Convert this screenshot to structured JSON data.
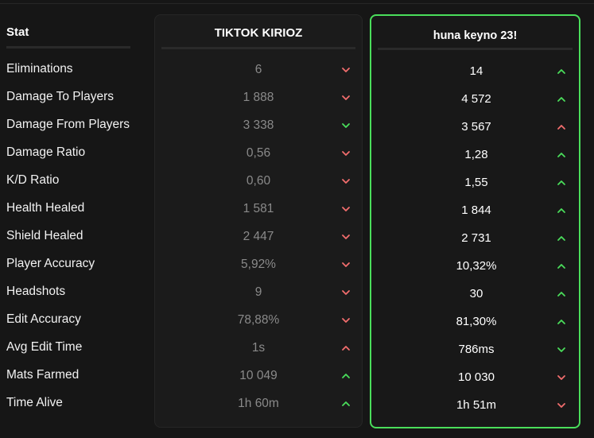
{
  "colors": {
    "up": "#4ade5b",
    "down": "#f26d6d",
    "highlight_border": "#4ade5b",
    "muted_value": "#8a8a8a"
  },
  "stat_header": "Stat",
  "players": [
    {
      "name": "TIKTOK KIRIOZ",
      "values": [
        {
          "value": "6",
          "trend": "down"
        },
        {
          "value": "1 888",
          "trend": "down"
        },
        {
          "value": "3 338",
          "trend": "down"
        },
        {
          "value": "0,56",
          "trend": "down"
        },
        {
          "value": "0,60",
          "trend": "down"
        },
        {
          "value": "1 581",
          "trend": "down"
        },
        {
          "value": "2 447",
          "trend": "down"
        },
        {
          "value": "5,92%",
          "trend": "down"
        },
        {
          "value": "9",
          "trend": "down"
        },
        {
          "value": "78,88%",
          "trend": "down"
        },
        {
          "value": "1s",
          "trend": "up"
        },
        {
          "value": "10 049",
          "trend": "up"
        },
        {
          "value": "1h 60m",
          "trend": "up"
        }
      ]
    },
    {
      "name": "huna keyno 23!",
      "values": [
        {
          "value": "14",
          "trend": "up"
        },
        {
          "value": "4 572",
          "trend": "up"
        },
        {
          "value": "3 567",
          "trend": "up"
        },
        {
          "value": "1,28",
          "trend": "up"
        },
        {
          "value": "1,55",
          "trend": "up"
        },
        {
          "value": "1 844",
          "trend": "up"
        },
        {
          "value": "2 731",
          "trend": "up"
        },
        {
          "value": "10,32%",
          "trend": "up"
        },
        {
          "value": "30",
          "trend": "up"
        },
        {
          "value": "81,30%",
          "trend": "up"
        },
        {
          "value": "786ms",
          "trend": "down"
        },
        {
          "value": "10 030",
          "trend": "down"
        },
        {
          "value": "1h 51m",
          "trend": "down"
        }
      ]
    }
  ],
  "chevron_colors": [
    [
      "#f26d6d",
      "#f26d6d",
      "#4ade5b",
      "#f26d6d",
      "#f26d6d",
      "#f26d6d",
      "#f26d6d",
      "#f26d6d",
      "#f26d6d",
      "#f26d6d",
      "#f26d6d",
      "#4ade5b",
      "#4ade5b"
    ],
    [
      "#4ade5b",
      "#4ade5b",
      "#f26d6d",
      "#4ade5b",
      "#4ade5b",
      "#4ade5b",
      "#4ade5b",
      "#4ade5b",
      "#4ade5b",
      "#4ade5b",
      "#4ade5b",
      "#f26d6d",
      "#f26d6d"
    ]
  ],
  "stats": [
    "Eliminations",
    "Damage To Players",
    "Damage From Players",
    "Damage Ratio",
    "K/D Ratio",
    "Health Healed",
    "Shield Healed",
    "Player Accuracy",
    "Headshots",
    "Edit Accuracy",
    "Avg Edit Time",
    "Mats Farmed",
    "Time Alive"
  ]
}
